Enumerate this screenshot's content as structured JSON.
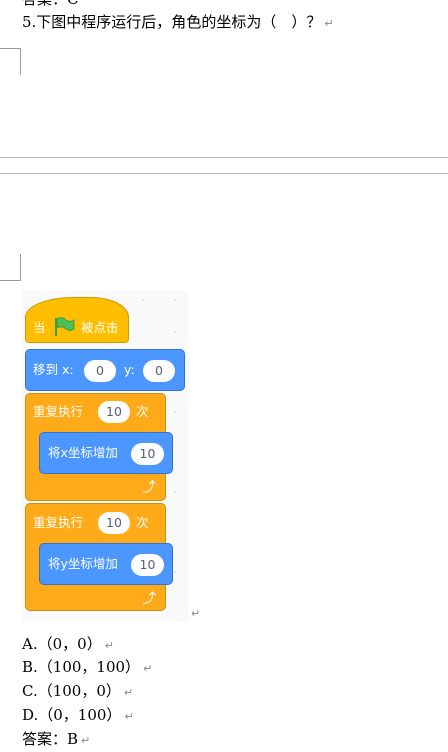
{
  "document": {
    "top_cut_line": "答案：C",
    "question": "5.下图中程序运行后，角色的坐标为（　）？",
    "paragraph_mark": "↵",
    "scratch": {
      "hat": {
        "when": "当",
        "clicked": "被点击",
        "flag_icon": "green-flag"
      },
      "goto": {
        "label": "移到 x:",
        "x_value": "0",
        "y_label": "y:",
        "y_value": "0"
      },
      "repeat1": {
        "label": "重复执行",
        "count": "10",
        "suffix": "次",
        "inner": {
          "label": "将x坐标增加",
          "value": "10"
        }
      },
      "repeat2": {
        "label": "重复执行",
        "count": "10",
        "suffix": "次",
        "inner": {
          "label": "将y坐标增加",
          "value": "10"
        }
      },
      "colors": {
        "event": "#ffbf00",
        "motion": "#4c97ff",
        "control": "#ffab19",
        "flag": "#4cbf56"
      }
    },
    "options": [
      "A.（0，0）",
      "B.（100，100）",
      "C.（100，0）",
      "D.（0，100）"
    ],
    "answer": "答案：B"
  }
}
